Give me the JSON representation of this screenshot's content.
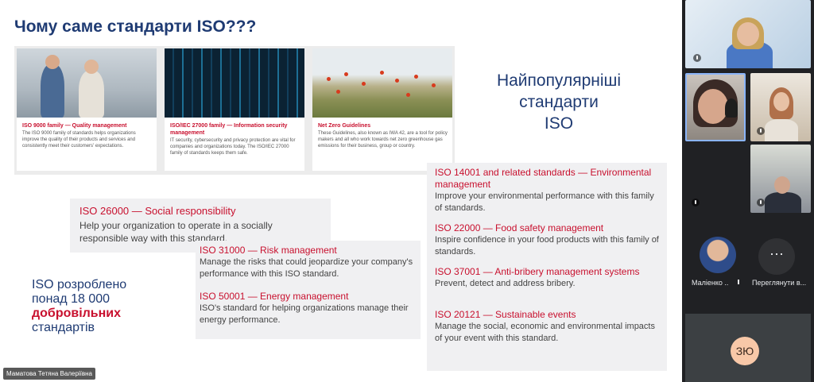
{
  "slide": {
    "title": "Чому саме стандарти ISO???",
    "cards": [
      {
        "title": "ISO 9000 family — Quality management",
        "desc": "The ISO 9000 family of standards helps organizations improve the quality of their products and services and consistently meet their customers' expectations."
      },
      {
        "title": "ISO/IEC 27000 family — Information security management",
        "desc": "IT security, cybersecurity and privacy protection are vital for companies and organizations today. The ISO/IEC 27000 family of standards keeps them safe."
      },
      {
        "title": "Net Zero Guidelines",
        "desc": "These Guidelines, also known as IWA 42, are a tool for policy makers and all who work towards net zero greenhouse gas emissions for their business, group or country."
      }
    ],
    "popular_lines": [
      "Найпопулярніші",
      "стандарти",
      "ISO"
    ],
    "standards_left": [
      {
        "title": "ISO 26000 — Social responsibility",
        "desc": "Help your organization to operate in a socially responsible way with this standard."
      }
    ],
    "standards_mid": [
      {
        "title": "ISO 31000 — Risk management",
        "desc": "Manage the risks that could jeopardize your company's performance with this ISO standard."
      },
      {
        "title": "ISO 50001 — Energy management",
        "desc": "ISO's standard for helping organizations manage their energy performance."
      }
    ],
    "standards_right": [
      {
        "title": "ISO 14001 and related standards — Environmental management",
        "desc": "Improve your environmental performance with this family of standards."
      },
      {
        "title": "ISO 22000 — Food safety management",
        "desc": "Inspire confidence in your food products with this family of standards."
      },
      {
        "title": "ISO 37001 — Anti-bribery management systems",
        "desc": "Prevent, detect and address bribery."
      },
      {
        "title": "ISO 20121 — Sustainable events",
        "desc": "Manage the social, economic and environmental impacts of your event with this standard."
      }
    ],
    "developed": {
      "line1": "ISO розроблено",
      "line2": "понад 18 000",
      "highlight": "добровільних",
      "line4": "стандартів"
    }
  },
  "presenter_name": "Маматова Тетяна Валеріївна",
  "participants": {
    "more_label": "Переглянути в...",
    "avatar_name": "Маліенко ...",
    "self_initials": "ЗЮ",
    "more_icon": "⋯"
  },
  "colors": {
    "accent_red": "#c8102e",
    "title_blue": "#1f3b73",
    "panel_bg": "#202124",
    "active_speaker": "#8ab4f8"
  }
}
